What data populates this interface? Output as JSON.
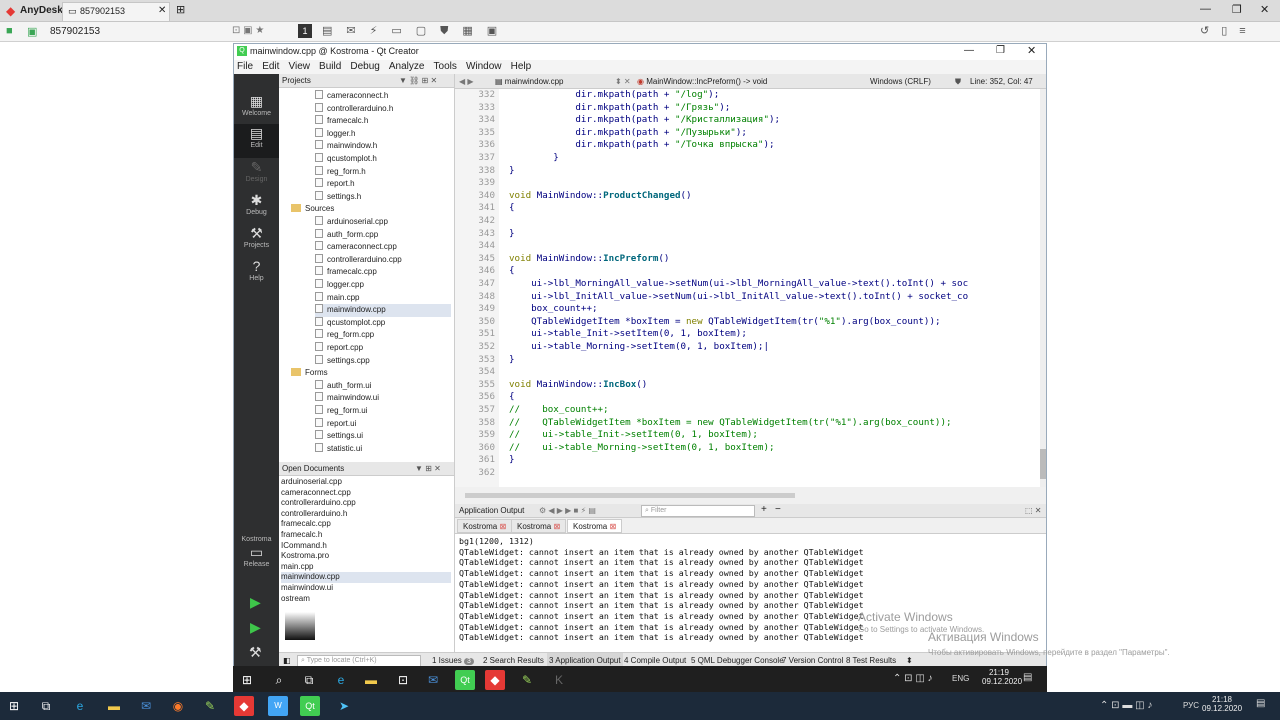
{
  "anydesk": {
    "app_name": "AnyDesk",
    "tab_label": "857902153",
    "address": "857902153"
  },
  "qt": {
    "title": "mainwindow.cpp @ Kostroma - Qt Creator",
    "menus": [
      "File",
      "Edit",
      "View",
      "Build",
      "Debug",
      "Analyze",
      "Tools",
      "Window",
      "Help"
    ],
    "modes": [
      {
        "label": "Welcome",
        "icon": "▦"
      },
      {
        "label": "Edit",
        "icon": "▤"
      },
      {
        "label": "Design",
        "icon": "✎"
      },
      {
        "label": "Debug",
        "icon": "✱"
      },
      {
        "label": "Projects",
        "icon": "⚒"
      },
      {
        "label": "Help",
        "icon": "?"
      }
    ],
    "kit": {
      "project": "Kostroma",
      "config": "Release"
    },
    "projects_header": "Projects",
    "tree": [
      {
        "t": "f",
        "label": "cameraconnect.h"
      },
      {
        "t": "f",
        "label": "controllerarduino.h"
      },
      {
        "t": "f",
        "label": "framecalc.h"
      },
      {
        "t": "f",
        "label": "logger.h"
      },
      {
        "t": "f",
        "label": "mainwindow.h"
      },
      {
        "t": "f",
        "label": "qcustomplot.h"
      },
      {
        "t": "f",
        "label": "reg_form.h"
      },
      {
        "t": "f",
        "label": "report.h"
      },
      {
        "t": "f",
        "label": "settings.h"
      },
      {
        "t": "d",
        "label": "Sources"
      },
      {
        "t": "f",
        "label": "arduinoserial.cpp"
      },
      {
        "t": "f",
        "label": "auth_form.cpp"
      },
      {
        "t": "f",
        "label": "cameraconnect.cpp"
      },
      {
        "t": "f",
        "label": "controllerarduino.cpp"
      },
      {
        "t": "f",
        "label": "framecalc.cpp"
      },
      {
        "t": "f",
        "label": "logger.cpp"
      },
      {
        "t": "f",
        "label": "main.cpp"
      },
      {
        "t": "f",
        "label": "mainwindow.cpp",
        "sel": true
      },
      {
        "t": "f",
        "label": "qcustomplot.cpp"
      },
      {
        "t": "f",
        "label": "reg_form.cpp"
      },
      {
        "t": "f",
        "label": "report.cpp"
      },
      {
        "t": "f",
        "label": "settings.cpp"
      },
      {
        "t": "d",
        "label": "Forms"
      },
      {
        "t": "f",
        "label": "auth_form.ui"
      },
      {
        "t": "f",
        "label": "mainwindow.ui"
      },
      {
        "t": "f",
        "label": "reg_form.ui"
      },
      {
        "t": "f",
        "label": "report.ui"
      },
      {
        "t": "f",
        "label": "settings.ui"
      },
      {
        "t": "f",
        "label": "statistic.ui"
      }
    ],
    "open_docs_header": "Open Documents",
    "open_docs": [
      "arduinoserial.cpp",
      "cameraconnect.cpp",
      "controllerarduino.cpp",
      "controllerarduino.h",
      "framecalc.cpp",
      "framecalc.h",
      "ICommand.h",
      "Kostroma.pro",
      "main.cpp",
      "mainwindow.cpp",
      "mainwindow.ui",
      "ostream"
    ],
    "open_docs_selected": "mainwindow.cpp",
    "editor": {
      "file": "mainwindow.cpp",
      "symbol": "MainWindow::IncPreform() -> void",
      "encoding": "Windows (CRLF)",
      "position": "Line: 352, Col: 47"
    },
    "code": [
      {
        "n": "332",
        "h": "            dir.mkpath(path + <span class=\"str\">\"/log\"</span>);"
      },
      {
        "n": "333",
        "h": "            dir.mkpath(path + <span class=\"str\">\"/Грязь\"</span>);"
      },
      {
        "n": "334",
        "h": "            dir.mkpath(path + <span class=\"str\">\"/Кристаллизация\"</span>);"
      },
      {
        "n": "335",
        "h": "            dir.mkpath(path + <span class=\"str\">\"/Пузырьки\"</span>);"
      },
      {
        "n": "336",
        "h": "            dir.mkpath(path + <span class=\"str\">\"/Точка впрыска\"</span>);"
      },
      {
        "n": "337",
        "h": "        }"
      },
      {
        "n": "338",
        "h": "}"
      },
      {
        "n": "339",
        "h": ""
      },
      {
        "n": "340",
        "h": "<span class=\"kw\">void</span> MainWindow::<span class=\"fn\">ProductChanged</span>()"
      },
      {
        "n": "341",
        "h": "{"
      },
      {
        "n": "342",
        "h": ""
      },
      {
        "n": "343",
        "h": "}"
      },
      {
        "n": "344",
        "h": ""
      },
      {
        "n": "345",
        "h": "<span class=\"kw\">void</span> MainWindow::<span class=\"fn\">IncPreform</span>()"
      },
      {
        "n": "346",
        "h": "{"
      },
      {
        "n": "347",
        "h": "    ui->lbl_MorningAll_value->setNum(ui->lbl_MorningAll_value->text().toInt() + soc"
      },
      {
        "n": "348",
        "h": "    ui->lbl_InitAll_value->setNum(ui->lbl_InitAll_value->text().toInt() + socket_co"
      },
      {
        "n": "349",
        "h": "    box_count++;"
      },
      {
        "n": "350",
        "h": "    QTableWidgetItem *boxItem = <span class=\"kw\">new</span> QTableWidgetItem(tr(<span class=\"str\">\"%1\"</span>).arg(box_count));"
      },
      {
        "n": "351",
        "h": "    ui->table_Init->setItem(0, 1, boxItem);"
      },
      {
        "n": "352",
        "h": "    ui->table_Morning->setItem(0, 1, boxItem);|"
      },
      {
        "n": "353",
        "h": "}"
      },
      {
        "n": "354",
        "h": ""
      },
      {
        "n": "355",
        "h": "<span class=\"kw\">void</span> MainWindow::<span class=\"fn\">IncBox</span>()"
      },
      {
        "n": "356",
        "h": "{"
      },
      {
        "n": "357",
        "h": "<span class=\"cm\">//    box_count++;</span>"
      },
      {
        "n": "358",
        "h": "<span class=\"cm\">//    QTableWidgetItem *boxItem = new QTableWidgetItem(tr(\"%1\").arg(box_count));</span>"
      },
      {
        "n": "359",
        "h": "<span class=\"cm\">//    ui->table_Init->setItem(0, 1, boxItem);</span>"
      },
      {
        "n": "360",
        "h": "<span class=\"cm\">//    ui->table_Morning->setItem(0, 1, boxItem);</span>"
      },
      {
        "n": "361",
        "h": "}"
      },
      {
        "n": "362",
        "h": ""
      }
    ],
    "output": {
      "header": "Application Output",
      "filter_placeholder": "Filter",
      "tabs": [
        "Kostroma",
        "Kostroma",
        "Kostroma"
      ],
      "lines": [
        "bg1(1200, 1312)",
        "QTableWidget: cannot insert an item that is already owned by another QTableWidget",
        "QTableWidget: cannot insert an item that is already owned by another QTableWidget",
        "QTableWidget: cannot insert an item that is already owned by another QTableWidget",
        "QTableWidget: cannot insert an item that is already owned by another QTableWidget",
        "QTableWidget: cannot insert an item that is already owned by another QTableWidget",
        "QTableWidget: cannot insert an item that is already owned by another QTableWidget",
        "QTableWidget: cannot insert an item that is already owned by another QTableWidget",
        "QTableWidget: cannot insert an item that is already owned by another QTableWidget",
        "QTableWidget: cannot insert an item that is already owned by another QTableWidget"
      ]
    },
    "status": {
      "locate_placeholder": "Type to locate (Ctrl+K)",
      "items": [
        "1 Issues",
        "2 Search Results",
        "3 Application Output",
        "4 Compile Output",
        "5 QML Debugger Console",
        "7 Version Control",
        "8 Test Results"
      ],
      "issues_count": "3"
    }
  },
  "guest_clock": {
    "time": "21:19",
    "date": "09.12.2020",
    "lang": "ENG"
  },
  "host_clock": {
    "time": "21:18",
    "date": "09.12.2020",
    "lang": "РУС"
  },
  "watermark": {
    "line1": "Activate Windows",
    "line2": "Go to Settings to activate Windows.",
    "line3": "Активация Windows",
    "line4": "Чтобы активировать Windows, перейдите в раздел \"Параметры\"."
  }
}
